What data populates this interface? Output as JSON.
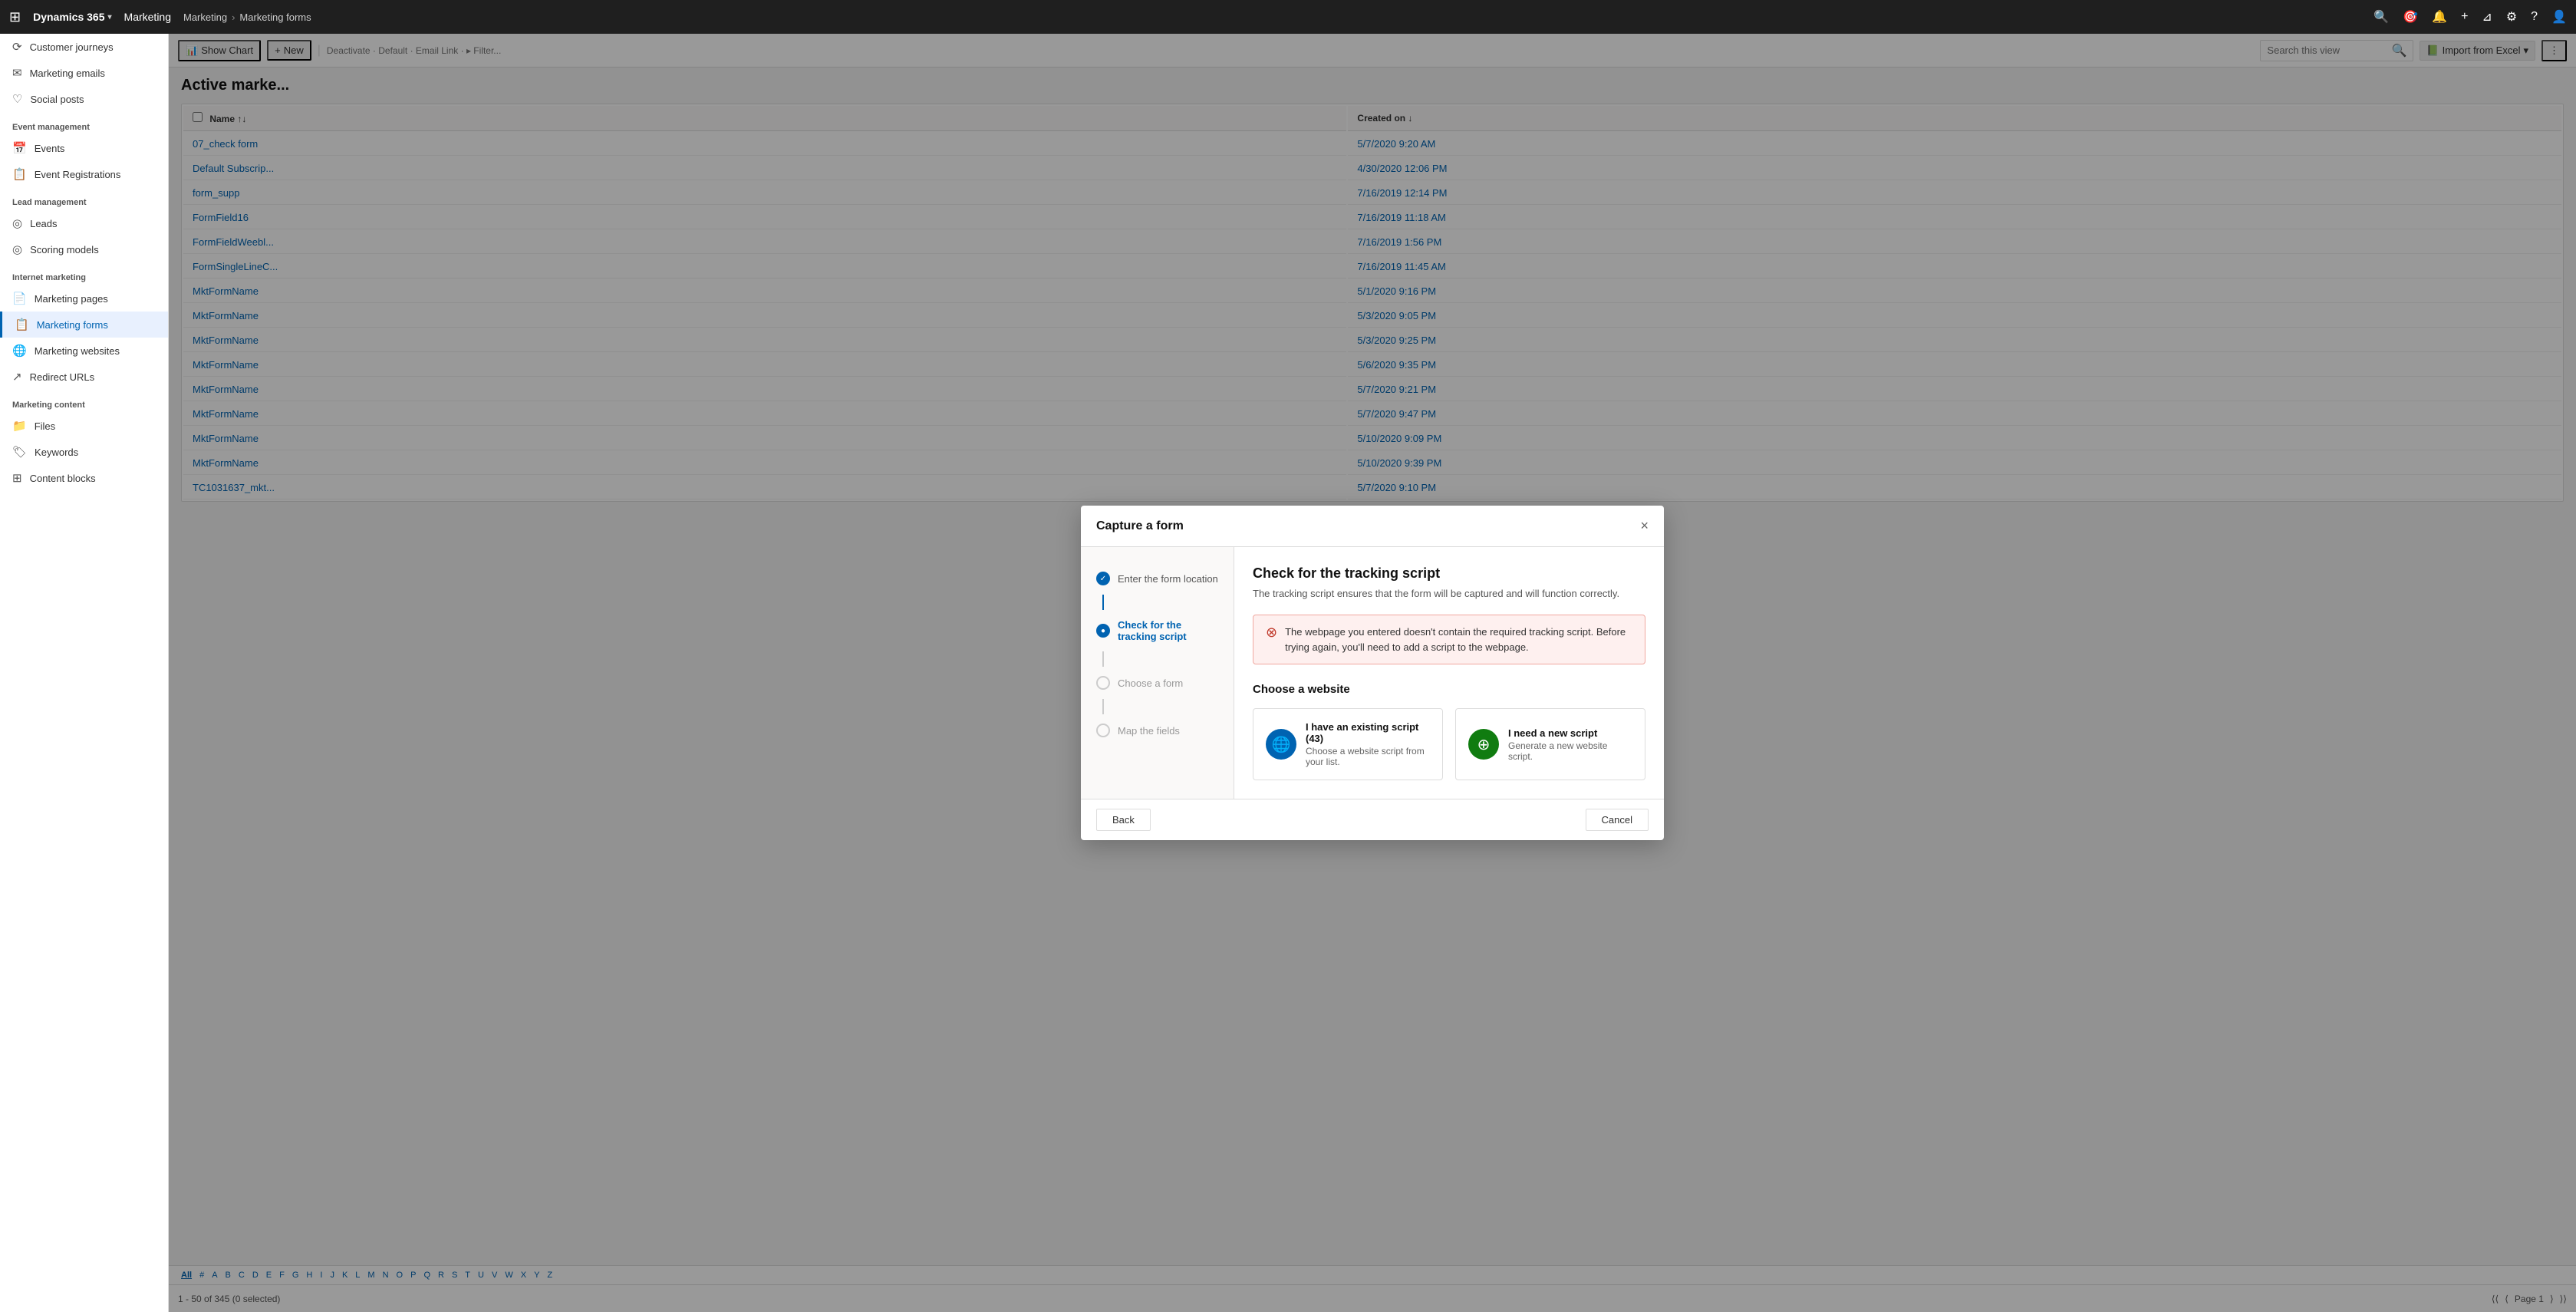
{
  "app": {
    "title": "Dynamics 365",
    "module": "Marketing",
    "breadcrumb_root": "Marketing",
    "breadcrumb_current": "Marketing forms"
  },
  "sidebar": {
    "sections": [
      {
        "label": "",
        "items": [
          {
            "id": "customer-journeys",
            "label": "Customer journeys",
            "icon": "⟳",
            "active": false
          },
          {
            "id": "marketing-emails",
            "label": "Marketing emails",
            "icon": "✉",
            "active": false
          },
          {
            "id": "social-posts",
            "label": "Social posts",
            "icon": "♡",
            "active": false
          }
        ]
      },
      {
        "label": "Event management",
        "items": [
          {
            "id": "events",
            "label": "Events",
            "icon": "☰",
            "active": false
          },
          {
            "id": "event-registrations",
            "label": "Event Registrations",
            "icon": "☰",
            "active": false
          }
        ]
      },
      {
        "label": "Lead management",
        "items": [
          {
            "id": "leads",
            "label": "Leads",
            "icon": "◎",
            "active": false
          },
          {
            "id": "scoring-models",
            "label": "Scoring models",
            "icon": "◎",
            "active": false
          }
        ]
      },
      {
        "label": "Internet marketing",
        "items": [
          {
            "id": "marketing-pages",
            "label": "Marketing pages",
            "icon": "☰",
            "active": false
          },
          {
            "id": "marketing-forms",
            "label": "Marketing forms",
            "icon": "☰",
            "active": true
          },
          {
            "id": "marketing-websites",
            "label": "Marketing websites",
            "icon": "⊕",
            "active": false
          },
          {
            "id": "redirect-urls",
            "label": "Redirect URLs",
            "icon": "↗",
            "active": false
          }
        ]
      },
      {
        "label": "Marketing content",
        "items": [
          {
            "id": "files",
            "label": "Files",
            "icon": "☰",
            "active": false
          },
          {
            "id": "keywords",
            "label": "Keywords",
            "icon": "⌂",
            "active": false
          },
          {
            "id": "content-blocks",
            "label": "Content blocks",
            "icon": "☰",
            "active": false
          }
        ]
      }
    ]
  },
  "toolbar": {
    "show_chart": "Show Chart",
    "new_label": "+",
    "import_excel": "Import from Excel"
  },
  "page": {
    "title": "Active marke...",
    "status": "1 - 50 of 345 (0 selected)"
  },
  "search": {
    "placeholder": "Search this view"
  },
  "table": {
    "columns": [
      "Name",
      "Created on"
    ],
    "rows": [
      {
        "name": "07_check form",
        "created": "5/7/2020 9:20 AM"
      },
      {
        "name": "Default Subscrip...",
        "created": "4/30/2020 12:06 PM"
      },
      {
        "name": "form_supp",
        "created": "7/16/2019 12:14 PM"
      },
      {
        "name": "FormField16",
        "created": "7/16/2019 11:18 AM"
      },
      {
        "name": "FormFieldWeebl...",
        "created": "7/16/2019 1:56 PM"
      },
      {
        "name": "FormSingleLineC...",
        "created": "7/16/2019 11:45 AM"
      },
      {
        "name": "MktFormName",
        "created": "5/1/2020 9:16 PM"
      },
      {
        "name": "MktFormName",
        "created": "5/3/2020 9:05 PM"
      },
      {
        "name": "MktFormName",
        "created": "5/3/2020 9:25 PM"
      },
      {
        "name": "MktFormName",
        "created": "5/6/2020 9:35 PM"
      },
      {
        "name": "MktFormName",
        "created": "5/7/2020 9:21 PM"
      },
      {
        "name": "MktFormName",
        "created": "5/7/2020 9:47 PM"
      },
      {
        "name": "MktFormName",
        "created": "5/10/2020 9:09 PM"
      },
      {
        "name": "MktFormName",
        "created": "5/10/2020 9:39 PM"
      },
      {
        "name": "TC1031637_mkt...",
        "created": "5/7/2020 9:10 PM"
      }
    ]
  },
  "alpha_nav": [
    "All",
    "#",
    "A",
    "B",
    "C",
    "D",
    "E",
    "F",
    "G",
    "H",
    "I",
    "J",
    "K",
    "L",
    "M",
    "N",
    "O",
    "P",
    "Q",
    "R",
    "S",
    "T",
    "U",
    "V",
    "W",
    "X",
    "Y",
    "Z"
  ],
  "alpha_active": "All",
  "modal": {
    "title": "Capture a form",
    "close_label": "×",
    "steps": [
      {
        "id": "enter-location",
        "label": "Enter the form location",
        "state": "completed"
      },
      {
        "id": "check-tracking",
        "label": "Check for the tracking script",
        "state": "active"
      },
      {
        "id": "choose-form",
        "label": "Choose a form",
        "state": "inactive"
      },
      {
        "id": "map-fields",
        "label": "Map the fields",
        "state": "inactive"
      }
    ],
    "content": {
      "heading": "Check for the tracking script",
      "subtitle": "The tracking script ensures that the form will be captured and will function correctly.",
      "error": {
        "text": "The webpage you entered doesn't contain the required tracking script. Before trying again, you'll need to add a script to the webpage."
      },
      "choose_website_label": "Choose a website",
      "options": [
        {
          "id": "existing-script",
          "icon": "🌐",
          "icon_type": "blue",
          "title": "I have an existing script (43)",
          "desc": "Choose a website script from your list."
        },
        {
          "id": "new-script",
          "icon": "+",
          "icon_type": "green",
          "title": "I need a new script",
          "desc": "Generate a new website script."
        }
      ]
    },
    "footer": {
      "back_label": "Back",
      "cancel_label": "Cancel"
    }
  },
  "pagination": {
    "current_page": "Page 1",
    "first": "⟨⟨",
    "prev": "⟨",
    "next": "⟩",
    "last": "⟩⟩"
  }
}
